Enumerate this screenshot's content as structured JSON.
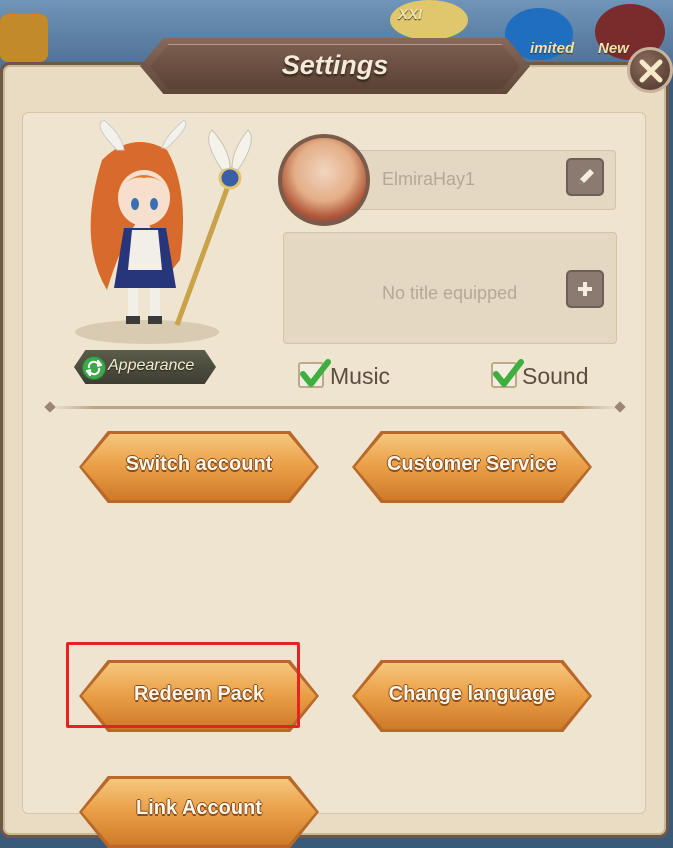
{
  "dialog": {
    "title": "Settings",
    "close_icon": "close-icon"
  },
  "background": {
    "badge_text": "XXI",
    "limited_text": "imited",
    "new_text": "New"
  },
  "profile": {
    "player_name": "ElmiraHay1",
    "title_placeholder": "No title equipped",
    "appearance_label": "Appearance"
  },
  "audio": {
    "music_label": "Music",
    "music_checked": true,
    "sound_label": "Sound",
    "sound_checked": true
  },
  "actions": {
    "switch_account": "Switch account",
    "customer_service": "Customer Service",
    "redeem_pack": "Redeem Pack",
    "change_language": "Change language",
    "link_account": "Link Account"
  },
  "colors": {
    "panel_bg": "#e9dcc3",
    "button_orange": "#e99e45",
    "highlight_red": "#e82222",
    "check_green": "#3fae3f"
  }
}
